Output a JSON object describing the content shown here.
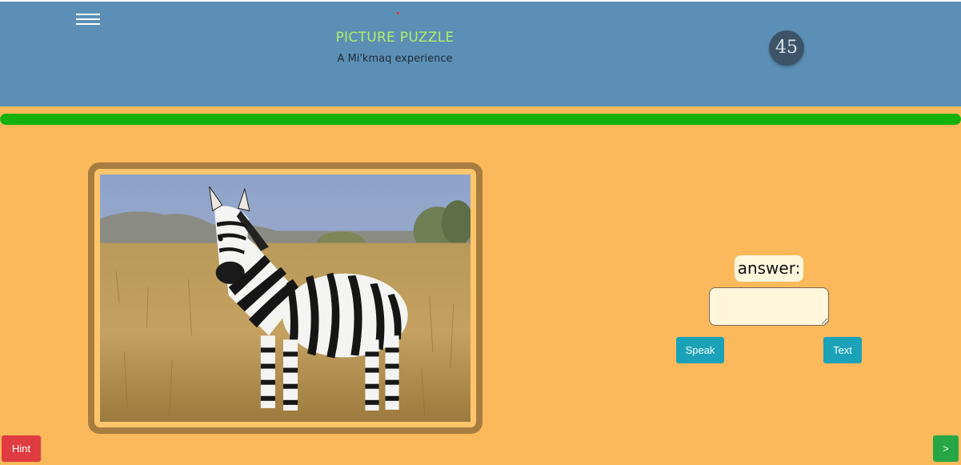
{
  "header": {
    "title": "PICTURE PUZZLE",
    "subtitle": "A Mi'kmaq experience",
    "timer": "45",
    "menu_icon": "hamburger-menu-icon"
  },
  "progress": {
    "fraction": 1.0,
    "color": "#13b10b"
  },
  "puzzle": {
    "image_subject": "zebra standing in dry savanna grass"
  },
  "answer": {
    "label": "answer:",
    "value": "",
    "placeholder": ""
  },
  "buttons": {
    "speak": "Speak",
    "text": "Text",
    "hint": "Hint",
    "next": ">"
  },
  "colors": {
    "header_bg": "#5b8fb5",
    "page_bg": "#fbb95c",
    "title": "#aff06a",
    "speak_text_btn": "#1aa2b8",
    "hint_btn": "#e03b41",
    "next_btn": "#27a645",
    "frame": "#a77c3f"
  }
}
